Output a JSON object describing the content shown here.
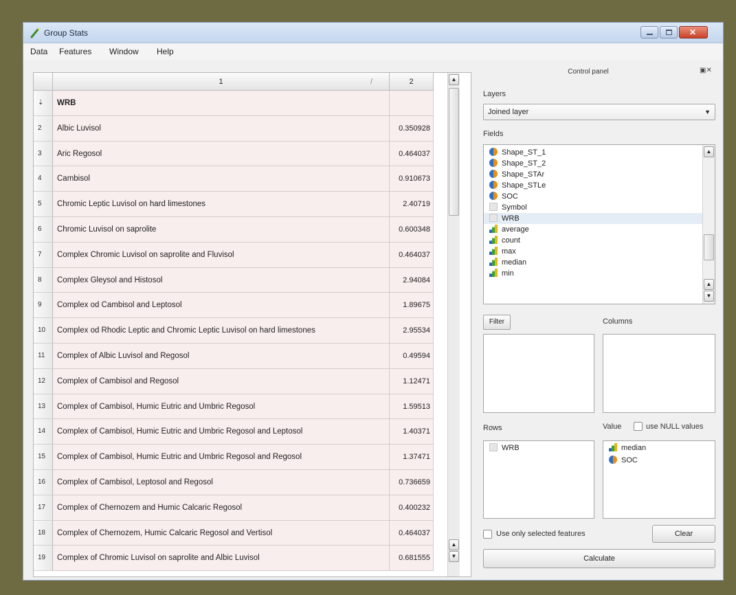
{
  "window": {
    "title": "Group Stats"
  },
  "menu": [
    "Data",
    "Features",
    "Window",
    "Help"
  ],
  "table": {
    "col1_header": "1",
    "col2_header": "2",
    "header_row_label": "WRB",
    "rows": [
      {
        "num": "2",
        "name": "Albic Luvisol",
        "value": "0.350928"
      },
      {
        "num": "3",
        "name": "Aric Regosol",
        "value": "0.464037"
      },
      {
        "num": "4",
        "name": "Cambisol",
        "value": "0.910673"
      },
      {
        "num": "5",
        "name": "Chromic Leptic Luvisol on hard limestones",
        "value": "2.40719"
      },
      {
        "num": "6",
        "name": "Chromic Luvisol on saprolite",
        "value": "0.600348"
      },
      {
        "num": "7",
        "name": "Complex Chromic Luvisol on saprolite and Fluvisol",
        "value": "0.464037"
      },
      {
        "num": "8",
        "name": "Complex Gleysol and Histosol",
        "value": "2.94084"
      },
      {
        "num": "9",
        "name": "Complex od Cambisol and Leptosol",
        "value": "1.89675"
      },
      {
        "num": "10",
        "name": "Complex od Rhodic Leptic and Chromic Leptic Luvisol on hard limestones",
        "value": "2.95534"
      },
      {
        "num": "11",
        "name": "Complex of Albic Luvisol and Regosol",
        "value": "0.49594"
      },
      {
        "num": "12",
        "name": "Complex of Cambisol and Regosol",
        "value": "1.12471"
      },
      {
        "num": "13",
        "name": "Complex of Cambisol, Humic Eutric and Umbric Regosol",
        "value": "1.59513"
      },
      {
        "num": "14",
        "name": "Complex of Cambisol, Humic Eutric and Umbric Regosol and Leptosol",
        "value": "1.40371"
      },
      {
        "num": "15",
        "name": "Complex of Cambisol, Humic Eutric and Umbric Regosol and Regosol",
        "value": "1.37471"
      },
      {
        "num": "16",
        "name": "Complex of Cambisol, Leptosol and Regosol",
        "value": "0.736659"
      },
      {
        "num": "17",
        "name": "Complex of Chernozem and Humic Calcaric Regosol",
        "value": "0.400232"
      },
      {
        "num": "18",
        "name": "Complex of Chernozem, Humic Calcaric Regosol and Vertisol",
        "value": "0.464037"
      },
      {
        "num": "19",
        "name": "Complex of Chromic Luvisol on saprolite and Albic Luvisol",
        "value": "0.681555"
      }
    ]
  },
  "control_panel": {
    "title": "Control panel",
    "layers_label": "Layers",
    "layer_selected": "Joined layer",
    "fields_label": "Fields",
    "fields": [
      {
        "name": "Shape_ST_1",
        "icon": "pie-icon"
      },
      {
        "name": "Shape_ST_2",
        "icon": "pie-icon"
      },
      {
        "name": "Shape_STAr",
        "icon": "pie-icon"
      },
      {
        "name": "Shape_STLe",
        "icon": "pie-icon"
      },
      {
        "name": "SOC",
        "icon": "pie-icon"
      },
      {
        "name": "Symbol",
        "icon": "text-icon"
      },
      {
        "name": "WRB",
        "icon": "text-icon"
      },
      {
        "name": "average",
        "icon": "bar-chart-icon"
      },
      {
        "name": "count",
        "icon": "bar-chart-icon"
      },
      {
        "name": "max",
        "icon": "bar-chart-icon"
      },
      {
        "name": "median",
        "icon": "bar-chart-icon"
      },
      {
        "name": "min",
        "icon": "bar-chart-icon"
      }
    ],
    "filter_button": "Filter",
    "columns_label": "Columns",
    "rows_label": "Rows",
    "value_label": "Value",
    "null_values_label": "use NULL values",
    "rows_items": [
      {
        "name": "WRB",
        "icon": "text-icon"
      }
    ],
    "value_items": [
      {
        "name": "median",
        "icon": "bar-chart-icon"
      },
      {
        "name": "SOC",
        "icon": "pie-icon"
      }
    ],
    "selected_only_label": "Use only selected features",
    "clear_button": "Clear",
    "calculate_button": "Calculate"
  }
}
